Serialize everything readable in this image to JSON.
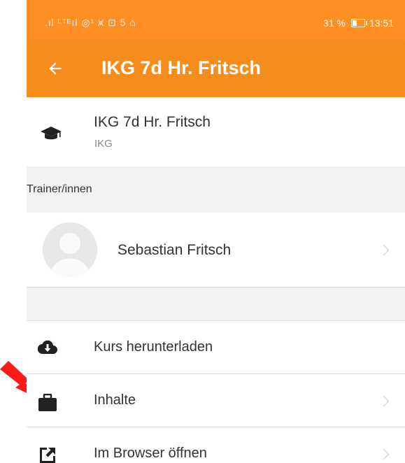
{
  "status_bar": {
    "left_glyphs": ".ıl ᴸᵀᴱıl ◎¹ ⩙ ⊡ 5 ⌂",
    "battery_text": "31 %",
    "battery_level": 0.31,
    "time": "13:51"
  },
  "app_bar": {
    "back_icon": "arrow-left-icon",
    "title": "IKG 7d Hr. Fritsch"
  },
  "course": {
    "icon": "graduation-cap-icon",
    "title": "IKG 7d Hr. Fritsch",
    "subtitle": "IKG"
  },
  "trainers_section": {
    "label": "Trainer/innen",
    "trainer": {
      "avatar_icon": "default-avatar-icon",
      "name": "Sebastian Fritsch"
    }
  },
  "actions": [
    {
      "icon": "cloud-download-icon",
      "label": "Kurs herunterladen",
      "chevron": false
    },
    {
      "icon": "briefcase-icon",
      "label": "Inhalte",
      "chevron": true
    },
    {
      "icon": "external-link-icon",
      "label": "Im Browser öffnen",
      "chevron": true
    }
  ],
  "colors": {
    "accent": "#f58d1d",
    "status_bar": "#ff8f23",
    "annotation_bolt": "#ff1a1a"
  }
}
